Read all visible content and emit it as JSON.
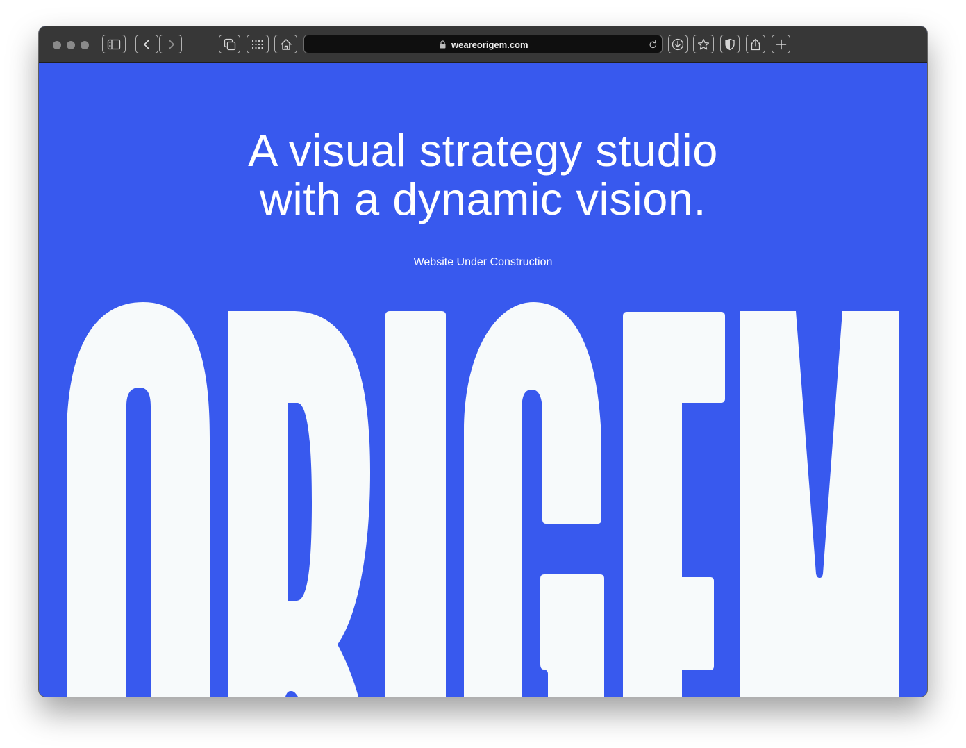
{
  "browser": {
    "url": "weareorigem.com",
    "icons": {
      "sidebar": "sidebar-icon",
      "back": "chevron-left-icon",
      "forward": "chevron-right-icon",
      "tabs": "tab-overview-icon",
      "grid": "grid-icon",
      "home": "home-icon",
      "lock": "lock-icon",
      "reload": "reload-icon",
      "download": "download-icon",
      "bookmark": "star-icon",
      "privacy": "shield-icon",
      "share": "share-icon",
      "new_tab": "plus-icon"
    }
  },
  "page": {
    "headline_line1": "A visual strategy studio",
    "headline_line2": "with a dynamic vision.",
    "subtitle": "Website Under Construction",
    "wordmark_text": "ORIGEM",
    "colors": {
      "background": "#3859ee",
      "wordmark": "#f7fafb",
      "text": "#ffffff"
    }
  }
}
